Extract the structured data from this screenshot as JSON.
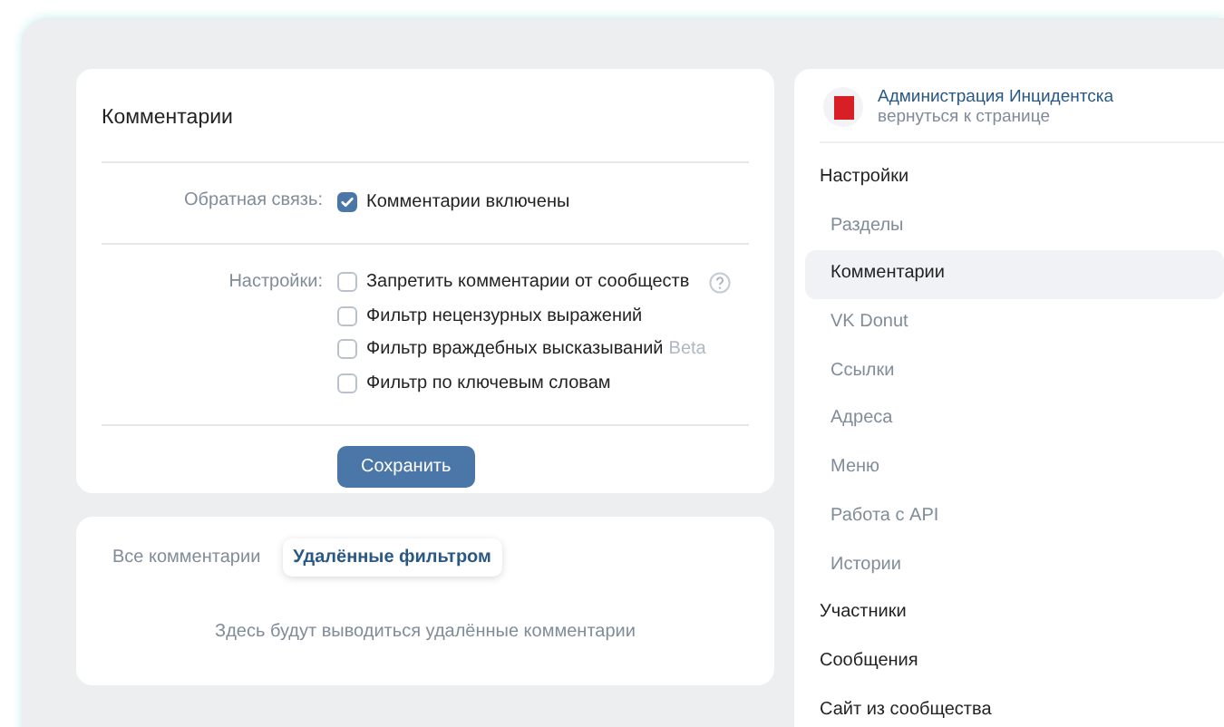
{
  "comments_card": {
    "title": "Комментарии",
    "feedback": {
      "label": "Обратная связь:",
      "option": {
        "label": "Комментарии включены",
        "checked": true
      }
    },
    "settings": {
      "label": "Настройки:",
      "options": [
        {
          "label": "Запретить комментарии от сообществ",
          "checked": false,
          "help": true
        },
        {
          "label": "Фильтр нецензурных выражений",
          "checked": false
        },
        {
          "label": "Фильтр враждебных высказываний",
          "checked": false,
          "tag": "Beta"
        },
        {
          "label": "Фильтр по ключевым словам",
          "checked": false
        }
      ]
    },
    "save_button": "Сохранить"
  },
  "deleted_card": {
    "tabs": [
      {
        "label": "Все комментарии",
        "selected": false
      },
      {
        "label": "Удалённые фильтром",
        "selected": true
      }
    ],
    "empty_text": "Здесь будут выводиться удалённые комментарии"
  },
  "sidebar": {
    "community": {
      "name": "Администрация Инцидентска",
      "link": "вернуться к странице"
    },
    "items": [
      {
        "label": "Настройки",
        "selected": false,
        "children": [
          {
            "label": "Разделы",
            "selected": false
          },
          {
            "label": "Комментарии",
            "selected": true
          },
          {
            "label": "VK Donut",
            "selected": false
          },
          {
            "label": "Ссылки",
            "selected": false
          },
          {
            "label": "Адреса",
            "selected": false
          },
          {
            "label": "Меню",
            "selected": false
          },
          {
            "label": "Работа с API",
            "selected": false
          },
          {
            "label": "Истории",
            "selected": false
          }
        ]
      },
      {
        "label": "Участники",
        "selected": false
      },
      {
        "label": "Сообщения",
        "selected": false
      },
      {
        "label": "Сайт из сообщества",
        "selected": false
      }
    ]
  }
}
